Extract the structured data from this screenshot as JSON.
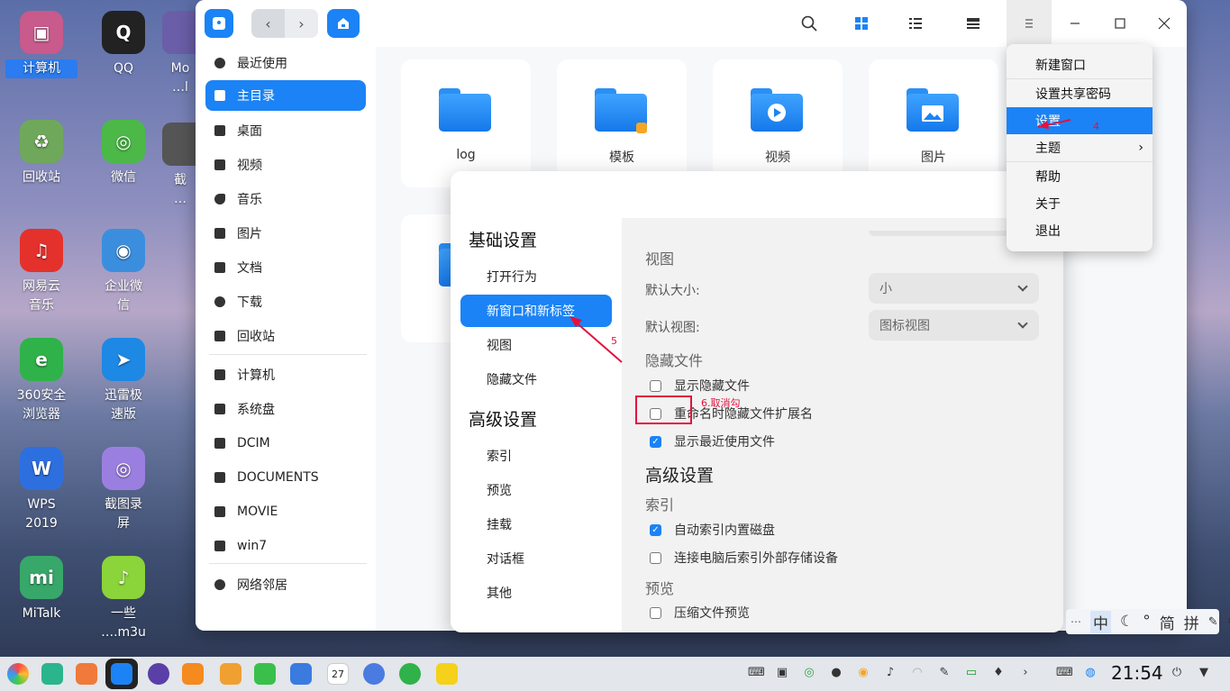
{
  "desktop": {
    "icons": [
      {
        "label": "计算机",
        "color": "#c85a8c",
        "glyph": "▣",
        "selected": true
      },
      {
        "label": "QQ",
        "color": "#222222",
        "glyph": "Q"
      },
      {
        "label": "回收站",
        "color": "#6fa85a",
        "glyph": "♻"
      },
      {
        "label": "微信",
        "color": "#4bb848",
        "glyph": "◎"
      },
      {
        "label": "网易云\n音乐",
        "color": "#e4312c",
        "glyph": "♫"
      },
      {
        "label": "企业微\n信",
        "color": "#3b8ede",
        "glyph": "◉"
      },
      {
        "label": "360安全\n浏览器",
        "color": "#2fb24a",
        "glyph": "e"
      },
      {
        "label": "迅雷极\n速版",
        "color": "#1e88e5",
        "glyph": "➤"
      },
      {
        "label": "WPS\n2019",
        "color": "#2e6fe0",
        "glyph": "W"
      },
      {
        "label": "截图录\n屏",
        "color": "#9b7fe0",
        "glyph": "◎"
      },
      {
        "label": "MiTalk",
        "color": "#37a86a",
        "glyph": "mi"
      },
      {
        "label": "一些\n….m3u",
        "color": "#8bd43a",
        "glyph": "♪"
      }
    ],
    "partial_labels": [
      "Mo\n…l",
      "截\n…"
    ]
  },
  "file_manager": {
    "sidebar": [
      {
        "label": "最近使用",
        "icon": "clock-icon"
      },
      {
        "label": "主目录",
        "icon": "home-icon",
        "active": true
      },
      {
        "label": "桌面",
        "icon": "desktop-icon"
      },
      {
        "label": "视频",
        "icon": "video-icon"
      },
      {
        "label": "音乐",
        "icon": "music-icon"
      },
      {
        "label": "图片",
        "icon": "picture-icon"
      },
      {
        "label": "文档",
        "icon": "document-icon"
      },
      {
        "label": "下载",
        "icon": "download-icon"
      },
      {
        "label": "回收站",
        "icon": "trash-icon"
      },
      {
        "label": "计算机",
        "icon": "computer-icon"
      },
      {
        "label": "系统盘",
        "icon": "disk-icon"
      },
      {
        "label": "DCIM",
        "icon": "drive-icon"
      },
      {
        "label": "DOCUMENTS",
        "icon": "drive-icon"
      },
      {
        "label": "MOVIE",
        "icon": "drive-icon"
      },
      {
        "label": "win7",
        "icon": "drive-icon"
      },
      {
        "label": "网络邻居",
        "icon": "network-icon"
      }
    ],
    "folders": [
      "log",
      "模板",
      "视频",
      "图片"
    ]
  },
  "settings": {
    "nav": {
      "basic_header": "基础设置",
      "basic_items": [
        "打开行为",
        "新窗口和新标签",
        "视图",
        "隐藏文件"
      ],
      "advanced_header": "高级设置",
      "advanced_items": [
        "索引",
        "预览",
        "挂载",
        "对话框",
        "其他"
      ]
    },
    "content": {
      "view_header": "视图",
      "default_size_label": "默认大小:",
      "default_size_value": "小",
      "default_view_label": "默认视图:",
      "default_view_value": "图标视图",
      "hidden_header": "隐藏文件",
      "show_hidden": "显示隐藏文件",
      "hide_ext_on_rename": "重命名时隐藏文件扩展名",
      "show_recent": "显示最近使用文件",
      "advanced_header": "高级设置",
      "index_header": "索引",
      "auto_index": "自动索引内置磁盘",
      "index_external": "连接电脑后索引外部存储设备",
      "preview_header": "预览",
      "compress_preview": "压缩文件预览"
    }
  },
  "menu": {
    "items": [
      "新建窗口",
      "设置共享密码",
      "设置",
      "主题",
      "帮助",
      "关于",
      "退出"
    ]
  },
  "annotations": {
    "step4": "4",
    "step5": "5",
    "step6": "6.取消勾"
  },
  "ime": {
    "items": [
      "中",
      "简",
      "拼"
    ]
  },
  "taskbar": {
    "time": "21:54",
    "calendar_day": "27"
  },
  "colors": {
    "accent": "#1b83f5",
    "annotation": "#e3123d"
  }
}
